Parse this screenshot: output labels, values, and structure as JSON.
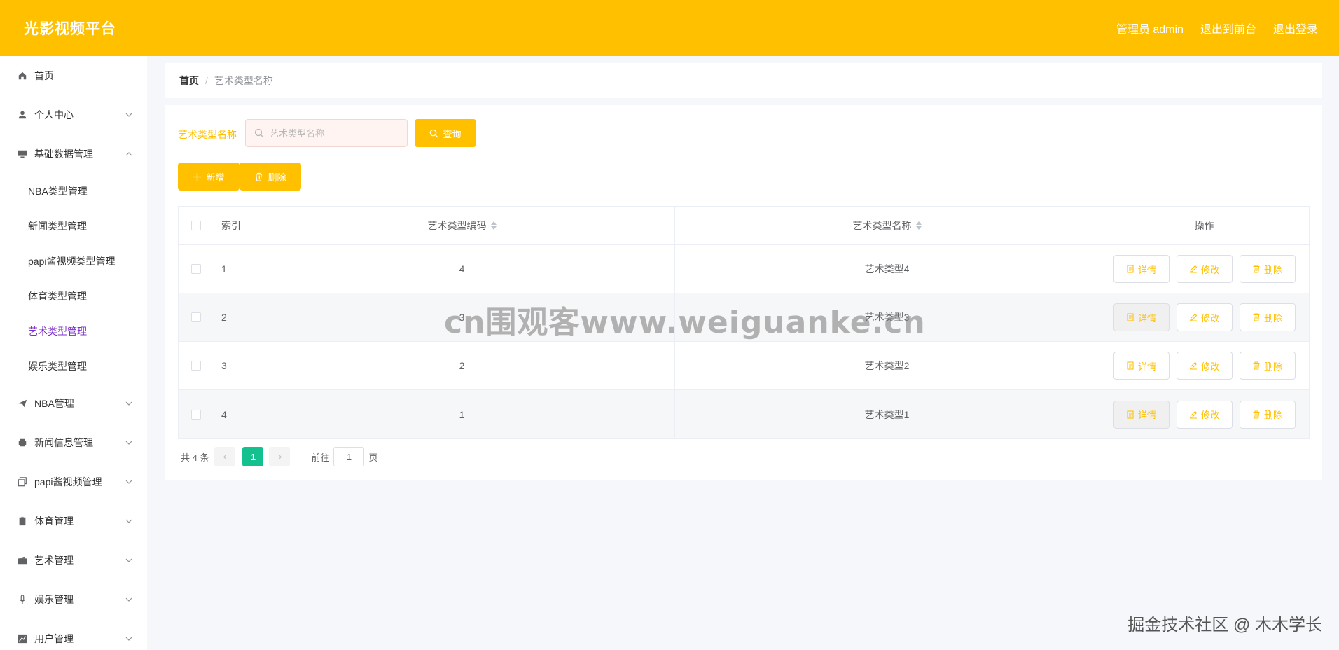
{
  "header": {
    "brand": "光影视频平台",
    "admin_label": "管理员 admin",
    "front_label": "退出到前台",
    "logout_label": "退出登录"
  },
  "sidebar": {
    "home": "首页",
    "personal": "个人中心",
    "basic": "基础数据管理",
    "sub_items": [
      "NBA类型管理",
      "新闻类型管理",
      "papi酱视频类型管理",
      "体育类型管理",
      "艺术类型管理",
      "娱乐类型管理"
    ],
    "active_sub": "艺术类型管理",
    "groups": [
      "NBA管理",
      "新闻信息管理",
      "papi酱视频管理",
      "体育管理",
      "艺术管理",
      "娱乐管理",
      "用户管理"
    ]
  },
  "breadcrumb": {
    "home": "首页",
    "separator": "/",
    "current": "艺术类型名称"
  },
  "search": {
    "label": "艺术类型名称",
    "placeholder": "艺术类型名称",
    "query_label": "查询"
  },
  "actions": {
    "add_label": "新增",
    "delete_label": "删除"
  },
  "table": {
    "headers": {
      "index": "索引",
      "code": "艺术类型编码",
      "name": "艺术类型名称",
      "ops": "操作"
    },
    "rows": [
      {
        "index": "1",
        "code": "4",
        "name": "艺术类型4"
      },
      {
        "index": "2",
        "code": "3",
        "name": "艺术类型3"
      },
      {
        "index": "3",
        "code": "2",
        "name": "艺术类型2"
      },
      {
        "index": "4",
        "code": "1",
        "name": "艺术类型1"
      }
    ],
    "op_labels": {
      "detail": "详情",
      "edit": "修改",
      "delete": "删除"
    }
  },
  "pager": {
    "total": "共 4 条",
    "current_page": "1",
    "goto_label": "前往",
    "goto_value": "1",
    "page_unit": "页"
  },
  "watermark": "cn围观客www.weiguanke.cn",
  "footer_mark": "掘金技术社区 @ 木木学长",
  "colors": {
    "header": "#ffc000",
    "accent": "#ffc000",
    "pager_active": "#13c18e",
    "menu_active": "#7b2ec9"
  }
}
